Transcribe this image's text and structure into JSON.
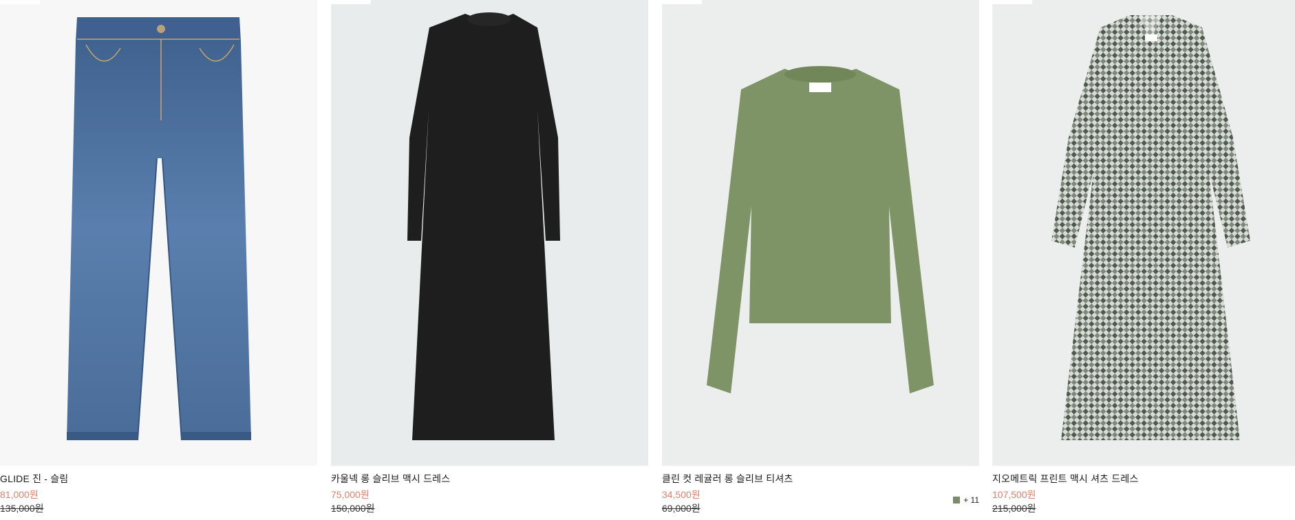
{
  "products": [
    {
      "name": "GLIDE 진 - 슬림",
      "sale_price": "81,000원",
      "original_price": "135,000원",
      "image_icon": "jeans-product-image",
      "bg_color": "#f7f7f7"
    },
    {
      "name": "카울넥 롱 슬리브 맥시 드레스",
      "sale_price": "75,000원",
      "original_price": "150,000원",
      "image_icon": "black-dress-product-image",
      "bg_color": "#e9ecec"
    },
    {
      "name": "클린 컷 레귤러 롱 슬리브 티셔츠",
      "sale_price": "34,500원",
      "original_price": "69,000원",
      "image_icon": "green-tshirt-product-image",
      "bg_color": "#eceeee",
      "swatch_color": "#7a8c6a",
      "more_colors": "+ 11"
    },
    {
      "name": "지오메트릭 프린트 맥시 셔츠 드레스",
      "sale_price": "107,500원",
      "original_price": "215,000원",
      "image_icon": "print-shirt-dress-product-image",
      "bg_color": "#eceeee"
    }
  ],
  "accent_sale_color": "#d9826a"
}
